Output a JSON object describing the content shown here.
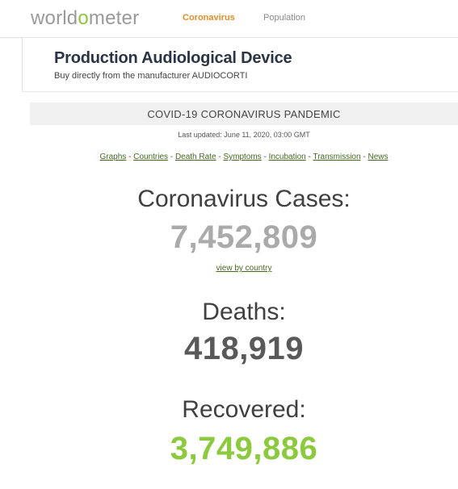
{
  "navbar": {
    "logo_part1": "world",
    "logo_o": "o",
    "logo_part2": "meter",
    "links": [
      {
        "label": "Coronavirus",
        "active": true
      },
      {
        "label": "Population",
        "active": false
      }
    ]
  },
  "ad": {
    "title": "Production Audiological Device",
    "subtitle": "Buy directly from the manufacturer AUDIOCORTI"
  },
  "main": {
    "section_title": "COVID-19 CORONAVIRUS PANDEMIC",
    "last_updated": "Last updated: June 11, 2020, 03:00 GMT",
    "quick_links": [
      "Graphs",
      "Countries",
      "Death Rate",
      "Symptoms",
      "Incubation",
      "Transmission",
      "News"
    ],
    "link_separator": "-",
    "cases": {
      "label": "Coronavirus Cases:",
      "value": "7,452,809",
      "link": "view by country"
    },
    "deaths": {
      "label": "Deaths:",
      "value": "418,919"
    },
    "recovered": {
      "label": "Recovered:",
      "value": "3,749,886"
    }
  },
  "colors": {
    "brand_green": "#8dc63f",
    "nav_active": "#e58e26",
    "link_green": "#44681e",
    "cases_gray": "#aaaaaa",
    "deaths_gray": "#595959",
    "recovered_green": "#8aca3c"
  }
}
